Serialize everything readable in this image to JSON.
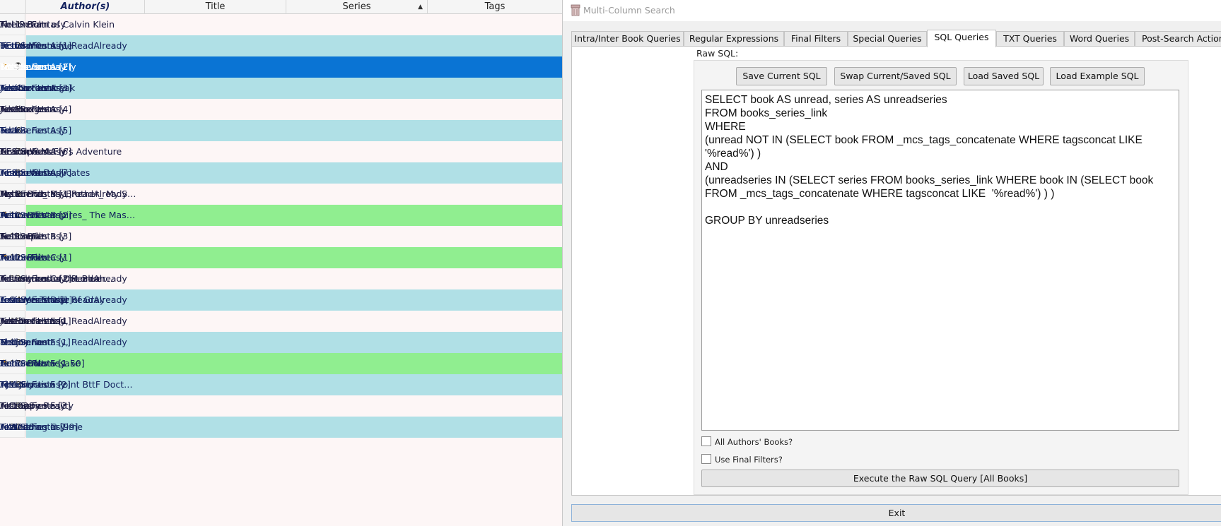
{
  "list": {
    "columns": [
      "Author(s)",
      "Title",
      "Series",
      "Tags"
    ],
    "rows": [
      {
        "num": "1",
        "author": "Ael L. Bolt",
        "title": "The Return of Calvin Klein",
        "series": "",
        "tags": "Fiction:Fantasy",
        "style": "white",
        "pinned": false,
        "current": false
      },
      {
        "num": "2",
        "author": "0Enidan0",
        "title": "In the Meantime",
        "series": "Test Series A [1]",
        "tags": "Fiction:Fantasy, ReadAlready",
        "style": "teal",
        "pinned": false,
        "current": false
      },
      {
        "num": "3",
        "author": "80'sLover",
        "title": "Time's Gunna Fly",
        "series": "Test Series A [2]",
        "tags": "Fiction:Fantasy",
        "style": "sel",
        "pinned": true,
        "current": true
      },
      {
        "num": "4",
        "author": "AceCartoonFreak",
        "title": "Jukebox Hero",
        "series": "Test Series A [3]",
        "tags": "Fiction:Fantasy",
        "style": "teal",
        "pinned": false,
        "current": false
      },
      {
        "num": "5",
        "author": "AceHodges",
        "title": "Jukebox Hero",
        "series": "Test Series A [4]",
        "tags": "Fiction:Fantasy",
        "style": "white",
        "pinned": false,
        "current": false
      },
      {
        "num": "6",
        "author": "adaris",
        "title": "Fact",
        "series": "Test Series A [5]",
        "tags": "Fiction:Fantasy",
        "style": "teal",
        "pinned": false,
        "current": false
      },
      {
        "num": "7",
        "author": "AEStarWars",
        "title": "Grandpa McFly's Adventure",
        "series": "Test Series A [6]",
        "tags": "Fiction:Fantasy",
        "style": "white",
        "pinned": false,
        "current": false
      },
      {
        "num": "8",
        "author": "AEStarWars",
        "title": "Temporal Duplicates",
        "series": "Test Series A [7]",
        "tags": "Fiction:Fantasy",
        "style": "teal",
        "pinned": false,
        "current": false
      },
      {
        "num": "9",
        "author": "Ael L. Bolt",
        "title": "My Friend_ My Brother_ My Son",
        "series": "Test Series B [1]",
        "tags": "Fiction:Fantasy, ReadAlready",
        "style": "white",
        "pinned": false,
        "current": false
      },
      {
        "num": "10",
        "author": "Ael L. Bolt",
        "title": "Prince of Vampires_ The Masqu...",
        "series": "Test Series B [2]",
        "tags": "Fiction:Fantasy",
        "style": "green",
        "pinned": true,
        "current": false
      },
      {
        "num": "11",
        "author": "Ael L. Bolt",
        "title": "So Simple",
        "series": "Test Series B [3]",
        "tags": "Fiction:Fantasy",
        "style": "white",
        "pinned": false,
        "current": false
      },
      {
        "num": "12",
        "author": "Ael L. Bolt",
        "title": "You're Alive",
        "series": "Test Series C [1]",
        "tags": "Fiction:Fantasy",
        "style": "green",
        "pinned": true,
        "current": false
      },
      {
        "num": "13",
        "author": "Adventures of the Blue Car",
        "title": "If I only had a DeLorean",
        "series": "Test Series C [2]",
        "tags": "Fiction:Fantasy, ReadAlready",
        "style": "white",
        "pinned": false,
        "current": false
      },
      {
        "num": "14",
        "author": "Love Me Tender",
        "title": "A Grayer Shade of Gray",
        "series": "Test Series D [1]",
        "tags": "Fiction:Fantasy, ReadAlready",
        "style": "teal",
        "pinned": false,
        "current": false
      },
      {
        "num": "15",
        "author": "Ace in da hood",
        "title": "Jukebox Hero",
        "series": "Test Series E [1]",
        "tags": "Fiction:Fantasy, ReadAlready",
        "style": "white",
        "pinned": false,
        "current": false
      },
      {
        "num": "16",
        "author": "ahiijny",
        "title": "Doc Sonnet",
        "series": "Test Series F [1]",
        "tags": "Fiction:Fantasy, ReadAlready",
        "style": "teal",
        "pinned": false,
        "current": false
      },
      {
        "num": "17",
        "author": "Ael L. Bolt",
        "title": "Cursed Namesake",
        "series": "Test Series F [1.50]",
        "tags": "Fiction:Fantasy",
        "style": "green",
        "pinned": true,
        "current": false
      },
      {
        "num": "18",
        "author": "AJMcFly",
        "title": "The Junction Point BttF Doctor ...",
        "series": "Test Series F [2]",
        "tags": "Fiction:Fantasy",
        "style": "teal",
        "pinned": false,
        "current": false
      },
      {
        "num": "19",
        "author": "AK1028",
        "title": "A Crappy Reality",
        "series": "Test Series F [3]",
        "tags": "Fiction:Fantasy",
        "style": "white",
        "pinned": false,
        "current": false
      },
      {
        "num": "20",
        "author": "AK1028",
        "title": "A Wedding in Time",
        "series": "Test Series G [99]",
        "tags": "Fiction:Fantasy",
        "style": "teal",
        "pinned": false,
        "current": false
      }
    ]
  },
  "dialog": {
    "title": "Multi-Column Search",
    "tabs": [
      {
        "label": "Intra/Inter Book Queries",
        "active": false
      },
      {
        "label": "Regular Expressions",
        "active": false
      },
      {
        "label": "Final Filters",
        "active": false
      },
      {
        "label": "Special Queries",
        "active": false
      },
      {
        "label": "SQL Queries",
        "active": true
      },
      {
        "label": "TXT Queries",
        "active": false
      },
      {
        "label": "Word Queries",
        "active": false
      },
      {
        "label": "Post-Search Actions",
        "active": false
      }
    ],
    "raw_sql_label": "Raw SQL:",
    "buttons": {
      "save": "Save Current SQL",
      "swap": "Swap Current/Saved SQL",
      "load_saved": "Load Saved SQL",
      "load_example": "Load Example SQL"
    },
    "sql_text": "SELECT book AS unread, series AS unreadseries\nFROM books_series_link\nWHERE\n(unread NOT IN (SELECT book FROM _mcs_tags_concatenate WHERE tagsconcat LIKE '%read%') )\nAND\n(unreadseries IN (SELECT series FROM books_series_link WHERE book IN (SELECT book FROM _mcs_tags_concatenate WHERE tagsconcat LIKE  '%read%') ) )\n\nGROUP BY unreadseries",
    "checkboxes": [
      {
        "label": "All Authors' Books?",
        "checked": false
      },
      {
        "label": "Use Final Filters?",
        "checked": false
      }
    ],
    "execute_label": "Execute the Raw SQL Query [All Books]",
    "exit_label": "Exit"
  },
  "colors": {
    "row_white": "#fdf6f6",
    "row_teal": "#b0e0e6",
    "row_green": "#90ee90",
    "row_selected": "#0a74d4",
    "pin_icon": "#d08a1a"
  }
}
